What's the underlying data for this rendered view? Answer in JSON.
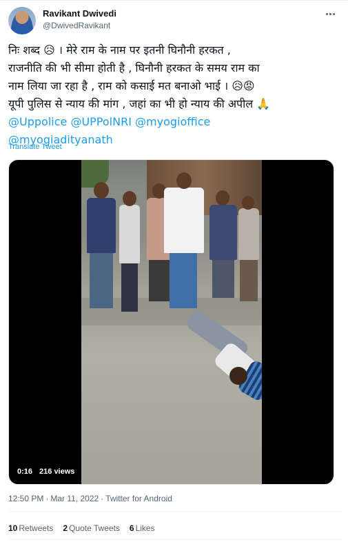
{
  "author": {
    "name": "Ravikant Dwivedi",
    "handle": "@DwivedRavikant"
  },
  "tweet": {
    "lines": [
      [
        "निः शब्द ",
        "😥",
        " । मेरे राम के नाम पर इतनी घिनौनी हरकत ,"
      ],
      [
        "राजनीति की भी सीमा होती है  , घिनौनी हरकत के समय राम का"
      ],
      [
        "नाम लिया जा रहा है , राम को कसाई मत बनाओ भाई । ",
        "😥😡"
      ],
      [
        "यूपी पुलिस से न्याय की मांग , जहां का भी हो न्याय की अपील ",
        "🙏"
      ]
    ],
    "mentions_line1": [
      "@Uppolice",
      "@UPPolNRI",
      "@myogioffice"
    ],
    "mentions_line2": [
      "@myogiadityanath"
    ],
    "translate_label": "Translate Tweet"
  },
  "video": {
    "time": "0:16",
    "views": "216 views"
  },
  "meta": {
    "time": "12:50 PM",
    "separator": "·",
    "date": "Mar 11, 2022",
    "source": "Twitter for Android"
  },
  "stats": [
    {
      "count": "10",
      "label": "Retweets"
    },
    {
      "count": "2",
      "label": "Quote Tweets"
    },
    {
      "count": "6",
      "label": "Likes"
    }
  ],
  "colors": {
    "link": "#1d9bf0",
    "text": "#0f1419",
    "secondary": "#536471"
  }
}
